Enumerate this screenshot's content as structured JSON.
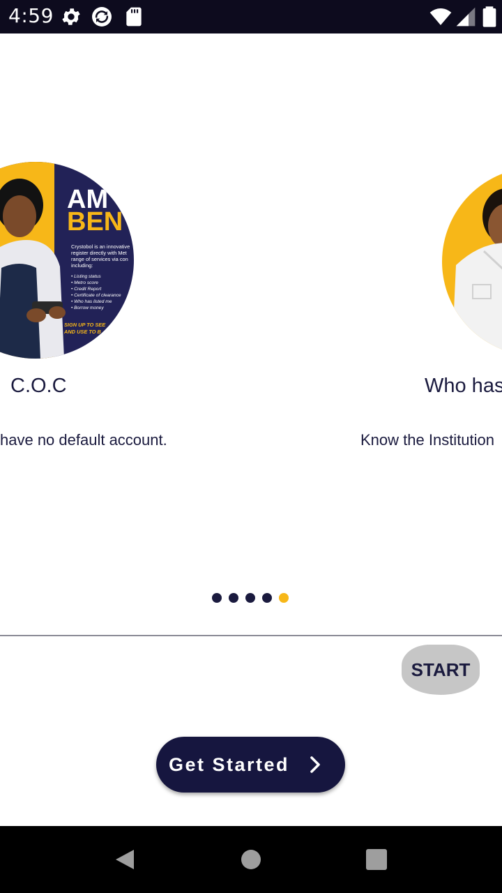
{
  "status_bar": {
    "time": "4:59",
    "icons": [
      "settings-gear-icon",
      "sync-icon",
      "sd-card-icon",
      "wifi-icon",
      "signal-icon",
      "battery-icon"
    ]
  },
  "carousel": {
    "slides": [
      {
        "title": "C.O.C",
        "description": "have no default account.",
        "image": {
          "headline_line1": "AM",
          "headline_line2": "BEN",
          "body": [
            "Crystobol is an innovative",
            "register directly with Met",
            "range of services via con",
            "including:"
          ],
          "bullets": [
            "Listing status",
            "Metro score",
            "Credit Report",
            "Certificate of clearance",
            "Who has listed me",
            "Borrow money"
          ],
          "cta": [
            "SIGN UP TO SEE",
            "AND USE TO B"
          ]
        }
      },
      {
        "title": "Who has",
        "description": "Know the Institution"
      }
    ],
    "page_count": 5,
    "active_page": 5
  },
  "actions": {
    "start_label": "START",
    "get_started_label": "Get Started"
  },
  "colors": {
    "navy": "#16163f",
    "accent": "#f7b718",
    "status_bar_bg": "#0d0b1e"
  }
}
